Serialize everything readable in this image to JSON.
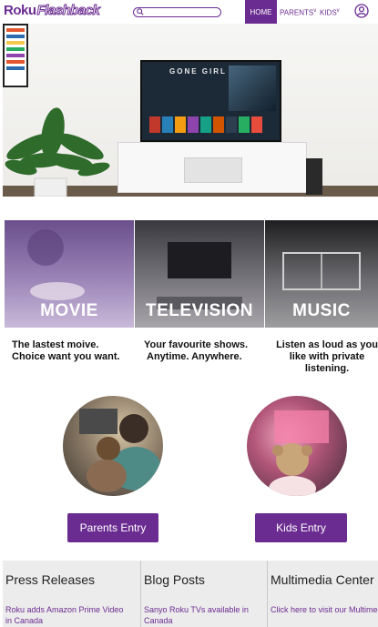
{
  "header": {
    "logo_brand": "Roku",
    "logo_sub": "Flashback",
    "nav": {
      "home": "HOME",
      "parents": "PARENTS",
      "kids": "KIDS",
      "dropdown_marker": "v"
    }
  },
  "categories": [
    {
      "label": "MOVIE",
      "desc_line1": "The lastest moive.",
      "desc_line2": "Choice want you want.",
      "desc_line3": ""
    },
    {
      "label": "TELEVISION",
      "desc_line1": "Your favourite shows.",
      "desc_line2": "Anytime. Anywhere.",
      "desc_line3": ""
    },
    {
      "label": "MUSIC",
      "desc_line1": "Listen as loud as you",
      "desc_line2": "like with private",
      "desc_line3": "listening."
    }
  ],
  "entries": {
    "parents": "Parents Entry",
    "kids": "Kids Entry"
  },
  "footer": {
    "press": {
      "title": "Press Releases",
      "link_line1": "Roku adds Amazon Prime Video",
      "link_line2": "in Canada"
    },
    "blog": {
      "title": "Blog Posts",
      "link_line1": "Sanyo Roku TVs available in",
      "link_line2": "Canada"
    },
    "multimedia": {
      "title": "Multimedia Center",
      "link_line1": "Click here to visit our Multimedia",
      "link_line2": ""
    }
  },
  "hero": {
    "tv_title": "GONE GIRL"
  },
  "colors": {
    "brand": "#6b2c91",
    "footer_bg": "#ececec"
  }
}
